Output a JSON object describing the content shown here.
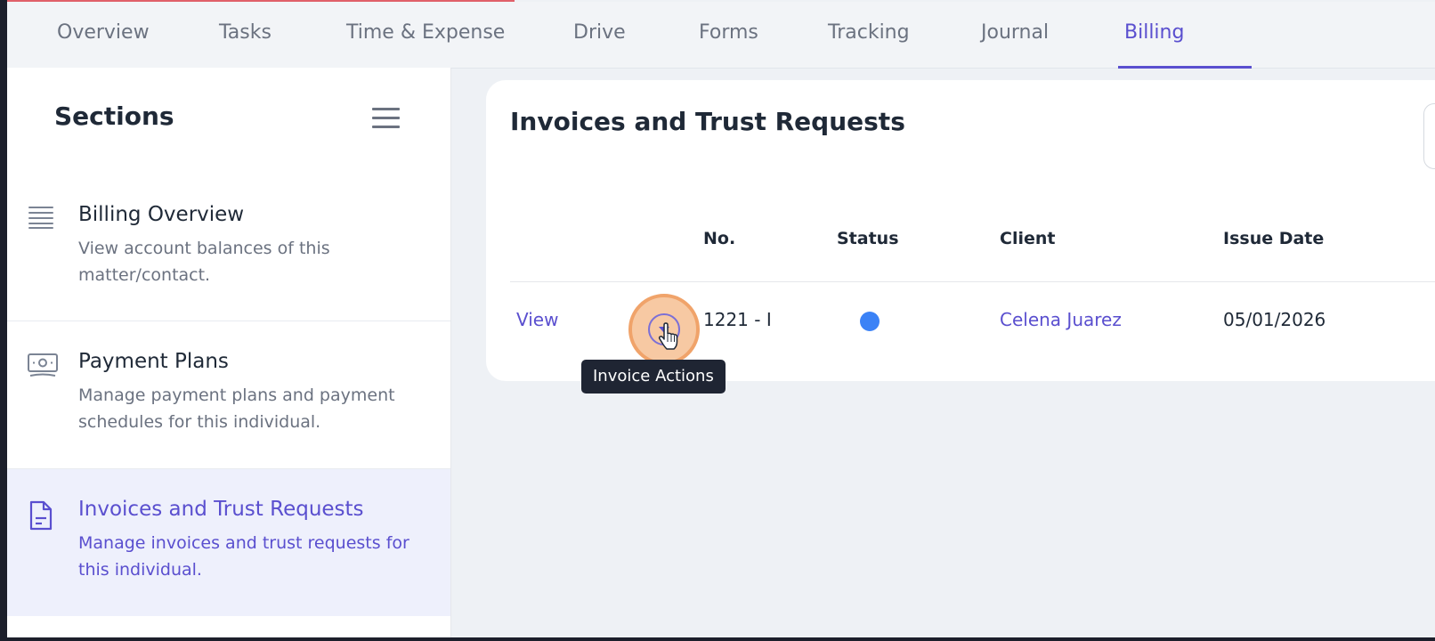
{
  "tabs": [
    {
      "label": "Overview"
    },
    {
      "label": "Tasks"
    },
    {
      "label": "Time & Expense"
    },
    {
      "label": "Drive"
    },
    {
      "label": "Forms"
    },
    {
      "label": "Tracking"
    },
    {
      "label": "Journal"
    },
    {
      "label": "Billing"
    }
  ],
  "active_tab": "Billing",
  "sidebar": {
    "title": "Sections",
    "items": [
      {
        "title": "Billing Overview",
        "description": "View account balances of this matter/contact.",
        "icon": "list-lines-icon"
      },
      {
        "title": "Payment Plans",
        "description": "Manage payment plans and payment schedules for this individual.",
        "icon": "money-bill-icon"
      },
      {
        "title": "Invoices and Trust Requests",
        "description": "Manage invoices and trust requests for this individual.",
        "icon": "document-icon"
      }
    ]
  },
  "main": {
    "title": "Invoices and Trust Requests",
    "columns": [
      "No.",
      "Status",
      "Client",
      "Issue Date"
    ],
    "rows": [
      {
        "view": "View",
        "no": "1221 - I",
        "status_color": "#3b82f6",
        "client": "Celena Juarez",
        "issue_date": "05/01/2026"
      }
    ],
    "tooltip": "Invoice Actions"
  },
  "colors": {
    "accent": "#5a4fcf",
    "highlight": "#f0a36a"
  }
}
